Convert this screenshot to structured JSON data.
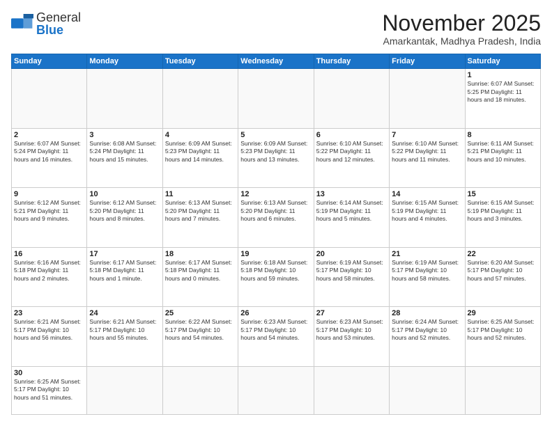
{
  "header": {
    "logo_general": "General",
    "logo_blue": "Blue",
    "month_title": "November 2025",
    "location": "Amarkantak, Madhya Pradesh, India"
  },
  "days_of_week": [
    "Sunday",
    "Monday",
    "Tuesday",
    "Wednesday",
    "Thursday",
    "Friday",
    "Saturday"
  ],
  "weeks": [
    [
      {
        "date": "",
        "info": ""
      },
      {
        "date": "",
        "info": ""
      },
      {
        "date": "",
        "info": ""
      },
      {
        "date": "",
        "info": ""
      },
      {
        "date": "",
        "info": ""
      },
      {
        "date": "",
        "info": ""
      },
      {
        "date": "1",
        "info": "Sunrise: 6:07 AM\nSunset: 5:25 PM\nDaylight: 11 hours\nand 18 minutes."
      }
    ],
    [
      {
        "date": "2",
        "info": "Sunrise: 6:07 AM\nSunset: 5:24 PM\nDaylight: 11 hours\nand 16 minutes."
      },
      {
        "date": "3",
        "info": "Sunrise: 6:08 AM\nSunset: 5:24 PM\nDaylight: 11 hours\nand 15 minutes."
      },
      {
        "date": "4",
        "info": "Sunrise: 6:09 AM\nSunset: 5:23 PM\nDaylight: 11 hours\nand 14 minutes."
      },
      {
        "date": "5",
        "info": "Sunrise: 6:09 AM\nSunset: 5:23 PM\nDaylight: 11 hours\nand 13 minutes."
      },
      {
        "date": "6",
        "info": "Sunrise: 6:10 AM\nSunset: 5:22 PM\nDaylight: 11 hours\nand 12 minutes."
      },
      {
        "date": "7",
        "info": "Sunrise: 6:10 AM\nSunset: 5:22 PM\nDaylight: 11 hours\nand 11 minutes."
      },
      {
        "date": "8",
        "info": "Sunrise: 6:11 AM\nSunset: 5:21 PM\nDaylight: 11 hours\nand 10 minutes."
      }
    ],
    [
      {
        "date": "9",
        "info": "Sunrise: 6:12 AM\nSunset: 5:21 PM\nDaylight: 11 hours\nand 9 minutes."
      },
      {
        "date": "10",
        "info": "Sunrise: 6:12 AM\nSunset: 5:20 PM\nDaylight: 11 hours\nand 8 minutes."
      },
      {
        "date": "11",
        "info": "Sunrise: 6:13 AM\nSunset: 5:20 PM\nDaylight: 11 hours\nand 7 minutes."
      },
      {
        "date": "12",
        "info": "Sunrise: 6:13 AM\nSunset: 5:20 PM\nDaylight: 11 hours\nand 6 minutes."
      },
      {
        "date": "13",
        "info": "Sunrise: 6:14 AM\nSunset: 5:19 PM\nDaylight: 11 hours\nand 5 minutes."
      },
      {
        "date": "14",
        "info": "Sunrise: 6:15 AM\nSunset: 5:19 PM\nDaylight: 11 hours\nand 4 minutes."
      },
      {
        "date": "15",
        "info": "Sunrise: 6:15 AM\nSunset: 5:19 PM\nDaylight: 11 hours\nand 3 minutes."
      }
    ],
    [
      {
        "date": "16",
        "info": "Sunrise: 6:16 AM\nSunset: 5:18 PM\nDaylight: 11 hours\nand 2 minutes."
      },
      {
        "date": "17",
        "info": "Sunrise: 6:17 AM\nSunset: 5:18 PM\nDaylight: 11 hours\nand 1 minute."
      },
      {
        "date": "18",
        "info": "Sunrise: 6:17 AM\nSunset: 5:18 PM\nDaylight: 11 hours\nand 0 minutes."
      },
      {
        "date": "19",
        "info": "Sunrise: 6:18 AM\nSunset: 5:18 PM\nDaylight: 10 hours\nand 59 minutes."
      },
      {
        "date": "20",
        "info": "Sunrise: 6:19 AM\nSunset: 5:17 PM\nDaylight: 10 hours\nand 58 minutes."
      },
      {
        "date": "21",
        "info": "Sunrise: 6:19 AM\nSunset: 5:17 PM\nDaylight: 10 hours\nand 58 minutes."
      },
      {
        "date": "22",
        "info": "Sunrise: 6:20 AM\nSunset: 5:17 PM\nDaylight: 10 hours\nand 57 minutes."
      }
    ],
    [
      {
        "date": "23",
        "info": "Sunrise: 6:21 AM\nSunset: 5:17 PM\nDaylight: 10 hours\nand 56 minutes."
      },
      {
        "date": "24",
        "info": "Sunrise: 6:21 AM\nSunset: 5:17 PM\nDaylight: 10 hours\nand 55 minutes."
      },
      {
        "date": "25",
        "info": "Sunrise: 6:22 AM\nSunset: 5:17 PM\nDaylight: 10 hours\nand 54 minutes."
      },
      {
        "date": "26",
        "info": "Sunrise: 6:23 AM\nSunset: 5:17 PM\nDaylight: 10 hours\nand 54 minutes."
      },
      {
        "date": "27",
        "info": "Sunrise: 6:23 AM\nSunset: 5:17 PM\nDaylight: 10 hours\nand 53 minutes."
      },
      {
        "date": "28",
        "info": "Sunrise: 6:24 AM\nSunset: 5:17 PM\nDaylight: 10 hours\nand 52 minutes."
      },
      {
        "date": "29",
        "info": "Sunrise: 6:25 AM\nSunset: 5:17 PM\nDaylight: 10 hours\nand 52 minutes."
      }
    ],
    [
      {
        "date": "30",
        "info": "Sunrise: 6:25 AM\nSunset: 5:17 PM\nDaylight: 10 hours\nand 51 minutes."
      },
      {
        "date": "",
        "info": ""
      },
      {
        "date": "",
        "info": ""
      },
      {
        "date": "",
        "info": ""
      },
      {
        "date": "",
        "info": ""
      },
      {
        "date": "",
        "info": ""
      },
      {
        "date": "",
        "info": ""
      }
    ]
  ]
}
